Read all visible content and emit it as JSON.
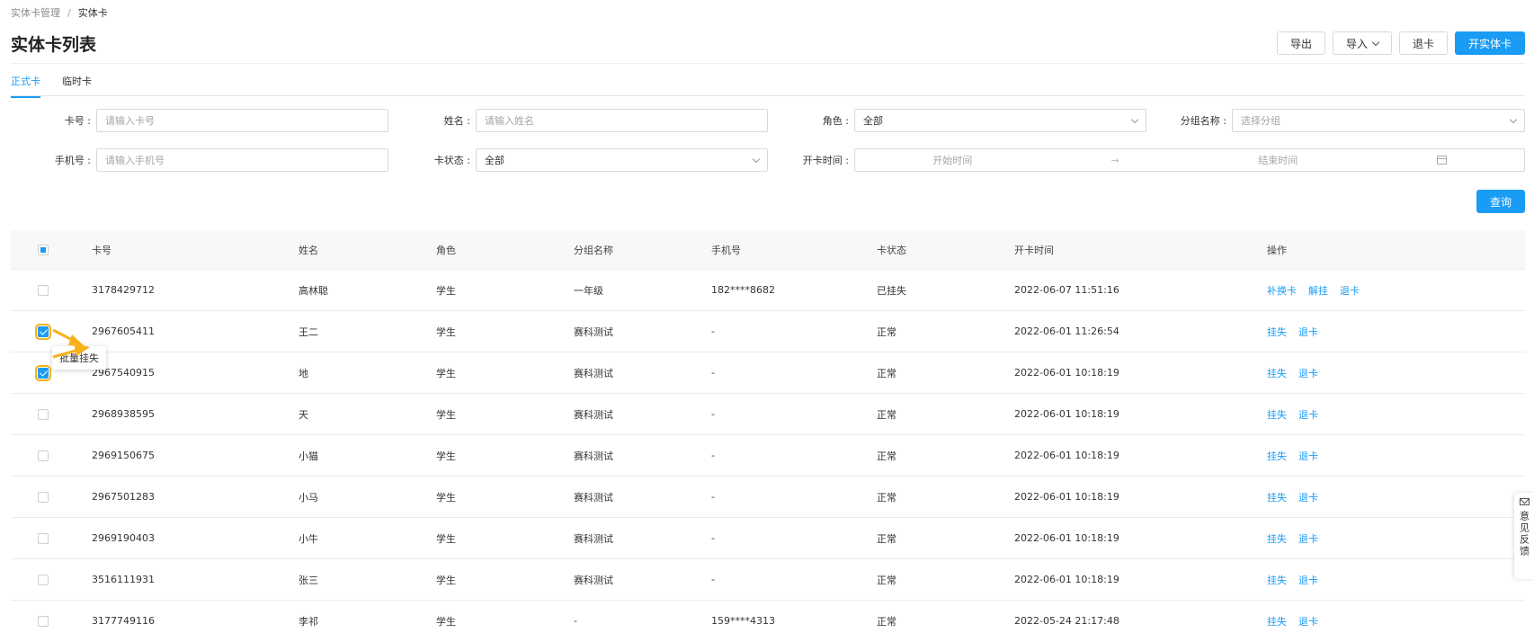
{
  "breadcrumb": {
    "parent": "实体卡管理",
    "separator": "/",
    "current": "实体卡"
  },
  "page_title": "实体卡列表",
  "actions": {
    "export": "导出",
    "import": "导入",
    "refund": "退卡",
    "open_card": "开实体卡"
  },
  "tabs": [
    {
      "label": "正式卡"
    },
    {
      "label": "临时卡"
    }
  ],
  "filters": {
    "card_no": {
      "label": "卡号 :",
      "placeholder": "请输入卡号"
    },
    "name": {
      "label": "姓名 :",
      "placeholder": "请输入姓名"
    },
    "role": {
      "label": "角色 :",
      "value": "全部"
    },
    "group": {
      "label": "分组名称 :",
      "placeholder": "选择分组"
    },
    "phone": {
      "label": "手机号 :",
      "placeholder": "请输入手机号"
    },
    "card_status": {
      "label": "卡状态 :",
      "value": "全部"
    },
    "open_time": {
      "label": "开卡时间 :",
      "start": "开始时间",
      "separator": "→",
      "end": "结束时间"
    },
    "query": "查询"
  },
  "table": {
    "columns": [
      "卡号",
      "姓名",
      "角色",
      "分组名称",
      "手机号",
      "卡状态",
      "开卡时间",
      "操作"
    ],
    "rows": [
      {
        "card": "3178429712",
        "name": "高林聪",
        "role": "学生",
        "group": "一年级",
        "phone": "182****8682",
        "status": "已挂失",
        "time": "2022-06-07 11:51:16",
        "ops": [
          "补换卡",
          "解挂",
          "退卡"
        ],
        "checked": false
      },
      {
        "card": "2967605411",
        "name": "王二",
        "role": "学生",
        "group": "赛科测试",
        "phone": "-",
        "status": "正常",
        "time": "2022-06-01 11:26:54",
        "ops": [
          "挂失",
          "退卡"
        ],
        "checked": true
      },
      {
        "card": "2967540915",
        "name": "地",
        "role": "学生",
        "group": "赛科测试",
        "phone": "-",
        "status": "正常",
        "time": "2022-06-01 10:18:19",
        "ops": [
          "挂失",
          "退卡"
        ],
        "checked": true
      },
      {
        "card": "2968938595",
        "name": "天",
        "role": "学生",
        "group": "赛科测试",
        "phone": "-",
        "status": "正常",
        "time": "2022-06-01 10:18:19",
        "ops": [
          "挂失",
          "退卡"
        ],
        "checked": false
      },
      {
        "card": "2969150675",
        "name": "小猫",
        "role": "学生",
        "group": "赛科测试",
        "phone": "-",
        "status": "正常",
        "time": "2022-06-01 10:18:19",
        "ops": [
          "挂失",
          "退卡"
        ],
        "checked": false
      },
      {
        "card": "2967501283",
        "name": "小马",
        "role": "学生",
        "group": "赛科测试",
        "phone": "-",
        "status": "正常",
        "time": "2022-06-01 10:18:19",
        "ops": [
          "挂失",
          "退卡"
        ],
        "checked": false
      },
      {
        "card": "2969190403",
        "name": "小牛",
        "role": "学生",
        "group": "赛科测试",
        "phone": "-",
        "status": "正常",
        "time": "2022-06-01 10:18:19",
        "ops": [
          "挂失",
          "退卡"
        ],
        "checked": false
      },
      {
        "card": "3516111931",
        "name": "张三",
        "role": "学生",
        "group": "赛科测试",
        "phone": "-",
        "status": "正常",
        "time": "2022-06-01 10:18:19",
        "ops": [
          "挂失",
          "退卡"
        ],
        "checked": false
      },
      {
        "card": "3177749116",
        "name": "李祁",
        "role": "学生",
        "group": "-",
        "phone": "159****4313",
        "status": "正常",
        "time": "2022-05-24 21:17:48",
        "ops": [
          "挂失",
          "退卡"
        ],
        "checked": false
      }
    ]
  },
  "tooltip": "批量挂失",
  "feedback": {
    "label": "意见反馈",
    "icon": "mail-icon"
  },
  "colors": {
    "primary": "#1a9cf5",
    "annotation": "#f5b21b"
  }
}
